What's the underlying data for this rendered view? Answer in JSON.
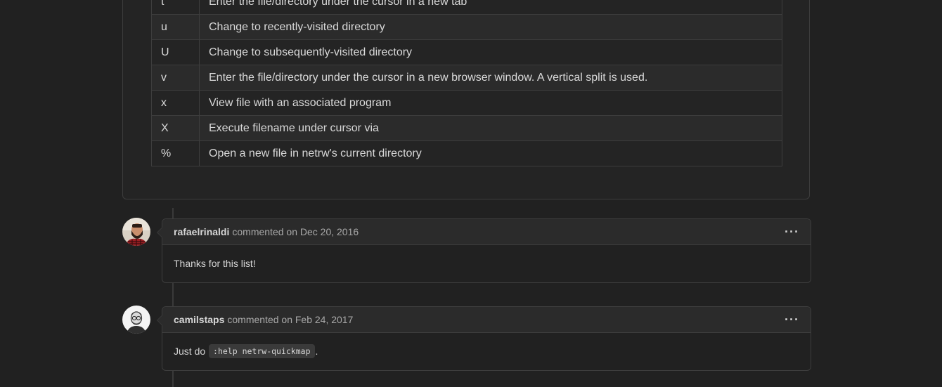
{
  "keymap_table": {
    "rows": [
      {
        "key": "t",
        "description": "Enter the file/directory under the cursor in a new tab"
      },
      {
        "key": "u",
        "description": "Change to recently-visited directory"
      },
      {
        "key": "U",
        "description": "Change to subsequently-visited directory"
      },
      {
        "key": "v",
        "description": "Enter the file/directory under the cursor in a new browser window. A vertical split is used."
      },
      {
        "key": "x",
        "description": "View file with an associated program"
      },
      {
        "key": "X",
        "description": "Execute filename under cursor via"
      },
      {
        "key": "%",
        "description": "Open a new file in netrw's current directory"
      }
    ]
  },
  "comments": [
    {
      "author": "rafaelrinaldi",
      "meta": "commented on Dec 20, 2016",
      "body": "Thanks for this list!",
      "more_icon": "kebab-horizontal-icon",
      "avatar_icon": "avatar-bearded-man"
    },
    {
      "author": "camilstaps",
      "meta": "commented on Feb 24, 2017",
      "body_prefix": "Just do",
      "body_code": ":help netrw-quickmap",
      "body_suffix": ".",
      "more_icon": "kebab-horizontal-icon",
      "avatar_icon": "avatar-man-glasses"
    }
  ],
  "colors": {
    "background": "#212121",
    "border": "#3d3d3d",
    "header_bg": "#2b2b2b"
  }
}
